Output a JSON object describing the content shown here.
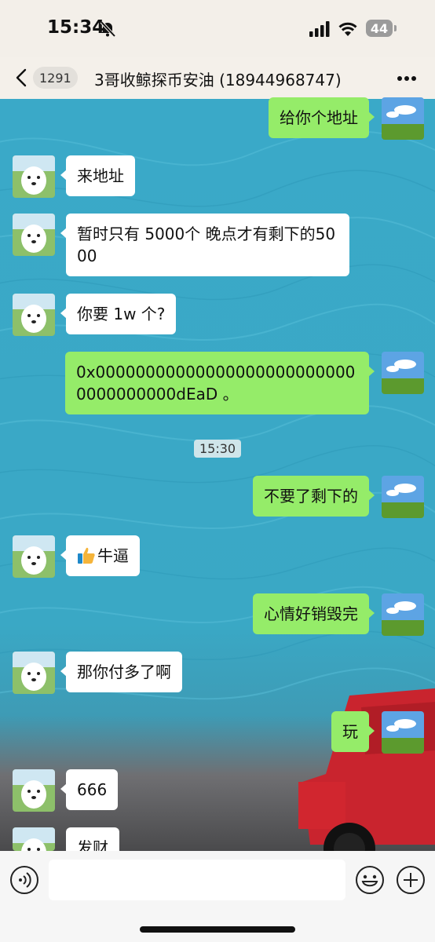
{
  "status_bar": {
    "time": "15:34",
    "battery": "44",
    "icons": [
      "bell-muted-icon",
      "signal-icon",
      "wifi-icon",
      "battery-icon"
    ]
  },
  "header": {
    "unread_count": "1291",
    "title": "3哥收鲸探币安油 (18944968747)",
    "icons": [
      "back-arrow-icon",
      "more-icon"
    ]
  },
  "messages": [
    {
      "side": "right",
      "text": "给你个地址"
    },
    {
      "side": "left",
      "text": "来地址"
    },
    {
      "side": "left",
      "text": "暂时只有 5000个  晚点才有剩下的5000"
    },
    {
      "side": "left",
      "text": "你要 1w 个?"
    },
    {
      "side": "right",
      "text": "0x000000000000000000000000000000000000dEaD 。"
    },
    {
      "side": "time",
      "text": "15:30"
    },
    {
      "side": "right",
      "text": "不要了剩下的"
    },
    {
      "side": "left",
      "text": "牛逼",
      "emoji": "thumbs-up-icon"
    },
    {
      "side": "right",
      "text": "心情好销毁完"
    },
    {
      "side": "left",
      "text": "那你付多了啊"
    },
    {
      "side": "right",
      "text": "玩"
    },
    {
      "side": "left",
      "text": "666"
    },
    {
      "side": "left",
      "text": "发财"
    }
  ],
  "input_bar": {
    "placeholder": "",
    "icons": [
      "voice-icon",
      "emoji-icon",
      "plus-icon"
    ]
  },
  "colors": {
    "chat_background": "#3aa9c8",
    "my_bubble": "#95ec69",
    "their_bubble": "#ffffff"
  }
}
